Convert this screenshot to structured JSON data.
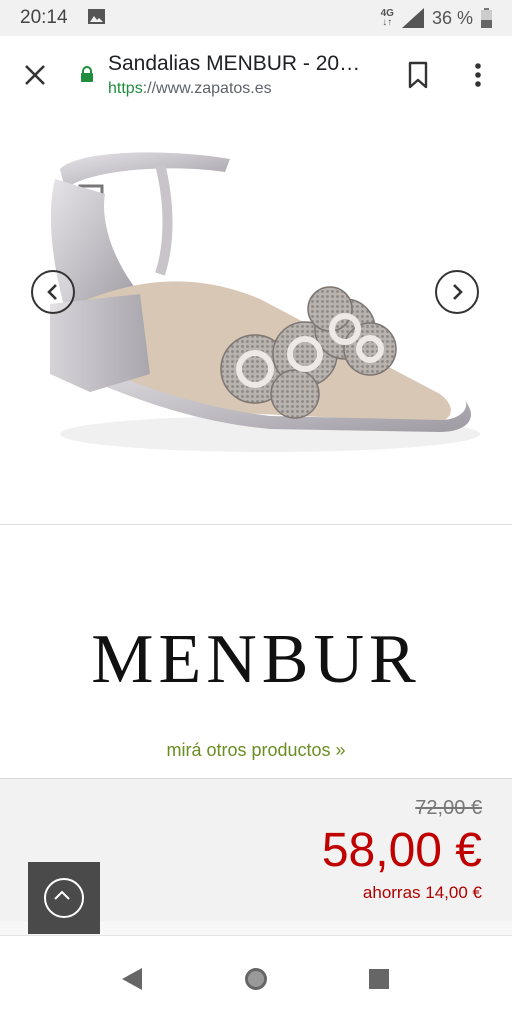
{
  "status_bar": {
    "time": "20:14",
    "network": "4G",
    "battery": "36 %"
  },
  "browser": {
    "title": "Sandalias MENBUR - 20…",
    "url_scheme": "https",
    "url_rest": "://www.zapatos.es",
    "icons": [
      "close-icon",
      "lock-icon",
      "bookmark-icon",
      "more-vert-icon"
    ]
  },
  "product": {
    "brand": "MENBUR",
    "other_products_link": "mirá otros productos »",
    "old_price": "72,00 €",
    "price": "58,00 €",
    "savings": "ahorras 14,00 €"
  },
  "colors": {
    "price_red": "#c00000",
    "link_green": "#6b8e23",
    "secure_green": "#1e8e3e"
  }
}
